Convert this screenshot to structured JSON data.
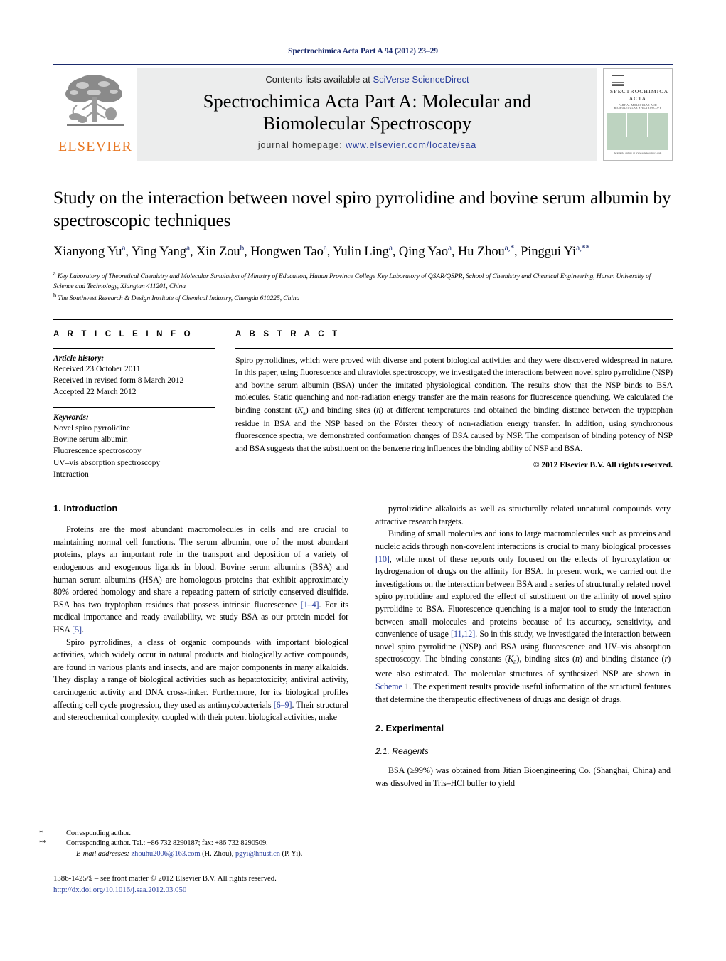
{
  "running_head": "Spectrochimica Acta Part A 94 (2012) 23–29",
  "masthead": {
    "publisher_name": "ELSEVIER",
    "contents_prefix": "Contents lists available at ",
    "contents_link": "SciVerse ScienceDirect",
    "journal_title_line1": "Spectrochimica Acta Part A: Molecular and",
    "journal_title_line2": "Biomolecular Spectroscopy",
    "homepage_label": "journal homepage:",
    "homepage_url": "www.elsevier.com/locate/saa",
    "cover": {
      "title_line1": "SPECTROCHIMICA",
      "title_line2": "ACTA",
      "subtitle": "PART A : MOLECULAR AND BIOMOLECULAR SPECTROSCOPY",
      "footer": "Available online at www.sciencedirect.com"
    }
  },
  "article": {
    "title": "Study on the interaction between novel spiro pyrrolidine and bovine serum albumin by spectroscopic techniques",
    "authors_html": "Xianyong Yu<sup>a</sup>, Ying Yang<sup>a</sup>, Xin Zou<sup>b</sup>, Hongwen Tao<sup>a</sup>, Yulin Ling<sup>a</sup>, Qing Yao<sup>a</sup>, Hu Zhou<sup>a,</sup><sup>*</sup>, Pinggui Yi<sup>a,</sup><sup>**</sup>",
    "affiliation_a": "Key Laboratory of Theoretical Chemistry and Molecular Simulation of Ministry of Education, Hunan Province College Key Laboratory of QSAR/QSPR, School of Chemistry and Chemical Engineering, Hunan University of Science and Technology, Xiangtan 411201, China",
    "affiliation_b": "The Southwest Research & Design Institute of Chemical Industry, Chengdu 610225, China"
  },
  "article_info": {
    "heading": "A R T I C L E    I N F O",
    "history_label": "Article history:",
    "history": [
      "Received 23 October 2011",
      "Received in revised form 8 March 2012",
      "Accepted 22 March 2012"
    ],
    "keywords_label": "Keywords:",
    "keywords": [
      "Novel spiro pyrrolidine",
      "Bovine serum albumin",
      "Fluorescence spectroscopy",
      "UV–vis absorption spectroscopy",
      "Interaction"
    ]
  },
  "abstract": {
    "heading": "A B S T R A C T",
    "text": "Spiro pyrrolidines, which were proved with diverse and potent biological activities and they were discovered widespread in nature. In this paper, using fluorescence and ultraviolet spectroscopy, we investigated the interactions between novel spiro pyrrolidine (NSP) and bovine serum albumin (BSA) under the imitated physiological condition. The results show that the NSP binds to BSA molecules. Static quenching and non-radiation energy transfer are the main reasons for fluorescence quenching. We calculated the binding constant (Ka) and binding sites (n) at different temperatures and obtained the binding distance between the tryptophan residue in BSA and the NSP based on the Förster theory of non-radiation energy transfer. In addition, using synchronous fluorescence spectra, we demonstrated conformation changes of BSA caused by NSP. The comparison of binding potency of NSP and BSA suggests that the substituent on the benzene ring influences the binding ability of NSP and BSA.",
    "copyright": "© 2012 Elsevier B.V. All rights reserved."
  },
  "sections": {
    "introduction_heading": "1.  Introduction",
    "experimental_heading": "2.  Experimental",
    "reagents_heading": "2.1.  Reagents"
  },
  "body": {
    "left_p1": "Proteins are the most abundant macromolecules in cells and are crucial to maintaining normal cell functions. The serum albumin, one of the most abundant proteins, plays an important role in the transport and deposition of a variety of endogenous and exogenous ligands in blood. Bovine serum albumins (BSA) and human serum albumins (HSA) are homologous proteins that exhibit approximately 80% ordered homology and share a repeating pattern of strictly conserved disulfide. BSA has two tryptophan residues that possess intrinsic fluorescence [1–4]. For its medical importance and ready availability, we study BSA as our protein model for HSA [5].",
    "left_p2": "Spiro pyrrolidines, a class of organic compounds with important biological activities, which widely occur in natural products and biologically active compounds, are found in various plants and insects, and are major components in many alkaloids. They display a range of biological activities such as hepatotoxicity, antiviral activity, carcinogenic activity and DNA cross-linker. Furthermore, for its biological profiles affecting cell cycle progression, they used as antimycobacterials [6–9]. Their structural and stereochemical complexity, coupled with their potent biological activities, make",
    "right_p1": "pyrrolizidine alkaloids as well as structurally related unnatural compounds very attractive research targets.",
    "right_p2": "Binding of small molecules and ions to large macromolecules such as proteins and nucleic acids through non-covalent interactions is crucial to many biological processes [10], while most of these reports only focused on the effects of hydroxylation or hydrogenation of drugs on the affinity for BSA. In present work, we carried out the investigations on the interaction between BSA and a series of structurally related novel spiro pyrrolidine and explored the effect of substituent on the affinity of novel spiro pyrrolidine to BSA. Fluorescence quenching is a major tool to study the interaction between small molecules and proteins because of its accuracy, sensitivity, and convenience of usage [11,12]. So in this study, we investigated the interaction between novel spiro pyrrolidine (NSP) and BSA using fluorescence and UV–vis absorption spectroscopy. The binding constants (Ka), binding sites (n) and binding distance (r) were also estimated. The molecular structures of synthesized NSP are shown in Scheme 1. The experiment results provide useful information of the structural features that determine the therapeutic effectiveness of drugs and design of drugs.",
    "right_p3": "BSA (≥99%) was obtained from Jitian Bioengineering Co. (Shanghai, China) and was dissolved in Tris–HCl buffer to yield"
  },
  "footnotes": {
    "line1": "Corresponding author.",
    "line1_marker": "*",
    "line2": "Corresponding author. Tel.: +86 732 8290187; fax: +86 732 8290509.",
    "line2_marker": "**",
    "email_label": "E-mail addresses:",
    "email1": "zhouhu2006@163.com",
    "email1_who": "(H. Zhou),",
    "email2": "pgyi@hnust.cn",
    "email2_who": "(P. Yi).",
    "issn_line": "1386-1425/$ – see front matter © 2012 Elsevier B.V. All rights reserved.",
    "doi": "http://dx.doi.org/10.1016/j.saa.2012.03.050"
  },
  "colors": {
    "link_blue": "#2a3f9d",
    "header_blue": "#1a2a6c",
    "elsevier_orange": "#e87722",
    "band_gray": "#eceded",
    "cover_green": "#bdd3c0"
  }
}
